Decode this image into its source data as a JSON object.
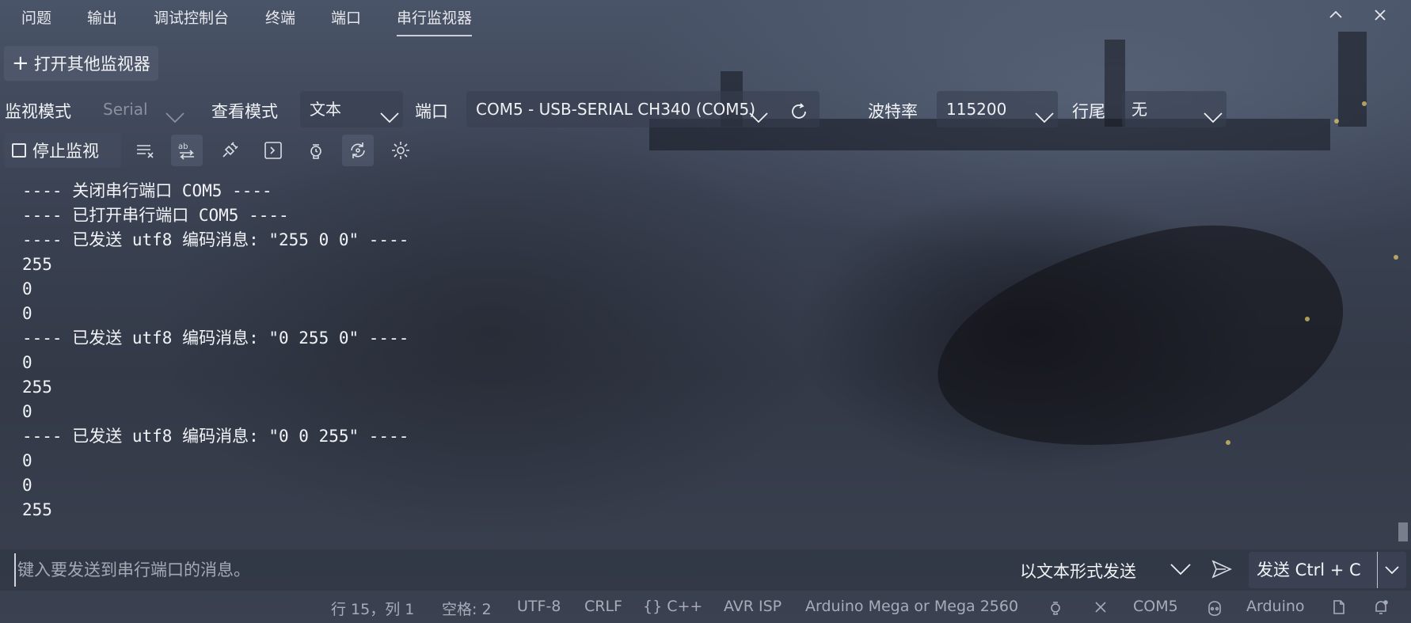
{
  "tabs": [
    {
      "label": "问题"
    },
    {
      "label": "输出"
    },
    {
      "label": "调试控制台"
    },
    {
      "label": "终端"
    },
    {
      "label": "端口"
    },
    {
      "label": "串行监视器",
      "active": true
    }
  ],
  "window_controls": {
    "collapse_icon": "chevron-up-icon",
    "close_icon": "close-icon"
  },
  "open_button": {
    "icon": "plus-icon",
    "label": "打开其他监视器"
  },
  "settings": {
    "monitor_mode_label": "监视模式",
    "monitor_mode_value": "Serial",
    "view_mode_label": "查看模式",
    "view_mode_value": "文本",
    "port_label": "端口",
    "port_value": "COM5 - USB-SERIAL CH340 (COM5)",
    "baud_label": "波特率",
    "baud_value": "115200",
    "line_ending_label": "行尾",
    "line_ending_value": "无"
  },
  "toolbar": {
    "stop_label": "停止监视",
    "tools": [
      "clear-output-icon",
      "word-wrap-icon",
      "plug-icon",
      "terminal-icon",
      "timestamp-icon",
      "auto-scroll-icon",
      "settings-gear-icon"
    ]
  },
  "output_lines": [
    "---- 关闭串行端口 COM5 ----",
    "---- 已打开串行端口 COM5 ----",
    "---- 已发送 utf8 编码消息: \"255 0 0\" ----",
    "255",
    "0",
    "0",
    "---- 已发送 utf8 编码消息: \"0 255 0\" ----",
    "0",
    "255",
    "0",
    "---- 已发送 utf8 编码消息: \"0 0 255\" ----",
    "0",
    "0",
    "255"
  ],
  "input": {
    "placeholder": "键入要发送到串行端口的消息。",
    "format_label": "以文本形式发送",
    "send_label": "发送 Ctrl + C"
  },
  "statusbar": {
    "position": "行 15，列 1",
    "spaces": "空格: 2",
    "encoding": "UTF-8",
    "eol": "CRLF",
    "language": "{} C++",
    "programmer": "AVR ISP",
    "board": "Arduino Mega or Mega 2560",
    "port": "COM5",
    "arduino": "Arduino"
  },
  "colors": {
    "accent": "#c9ced8",
    "panel_bg": "#333947"
  }
}
